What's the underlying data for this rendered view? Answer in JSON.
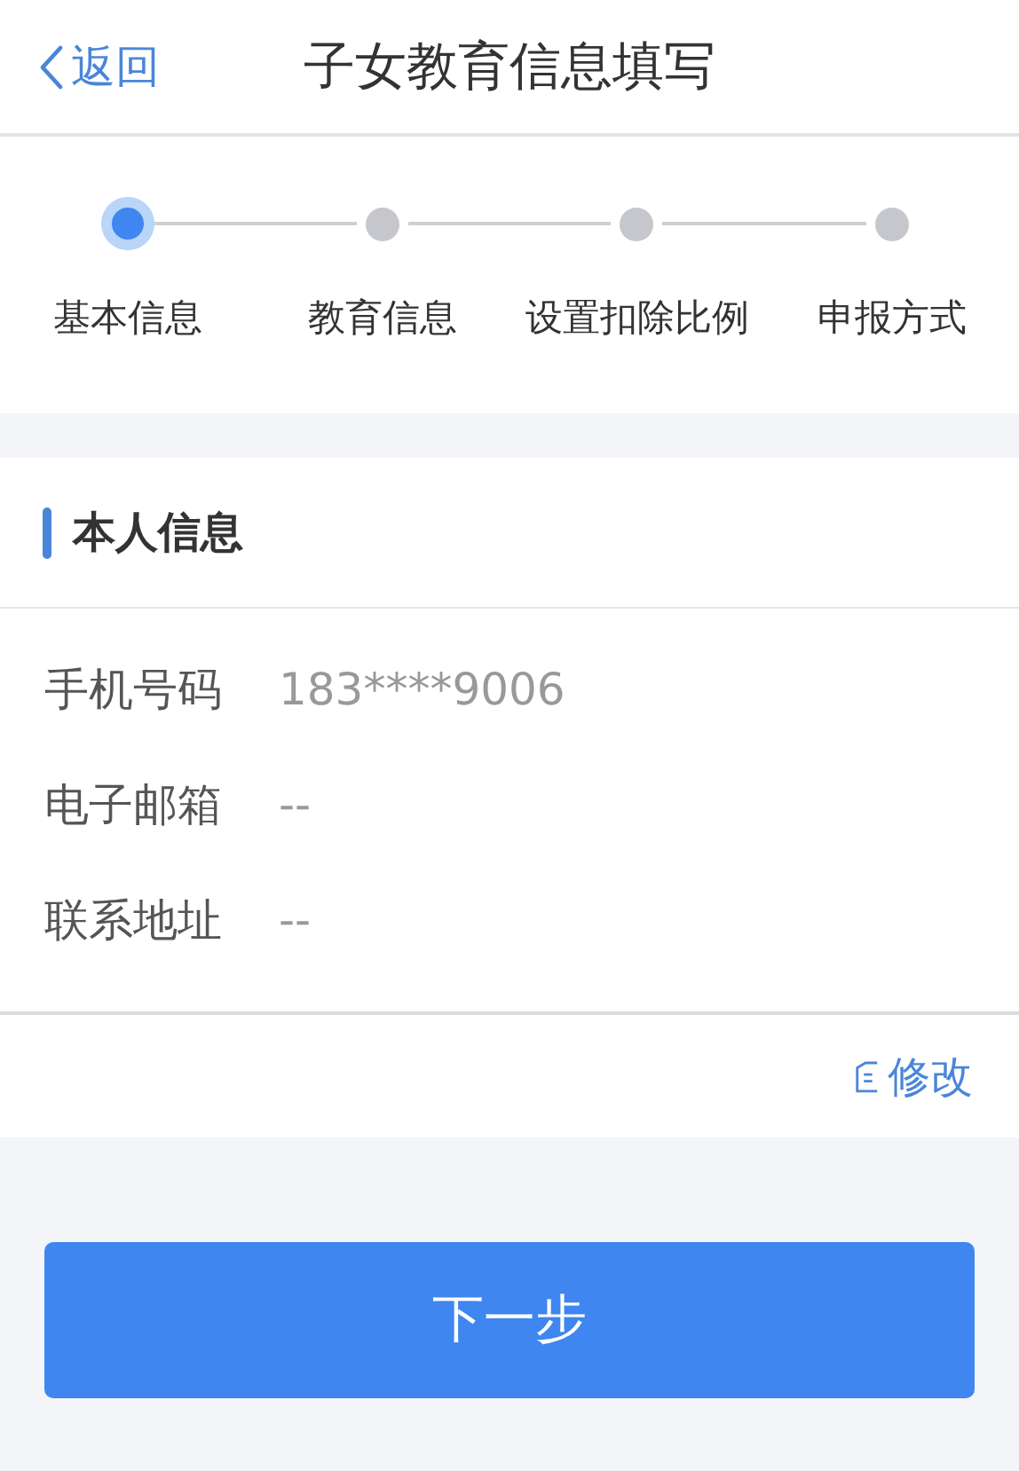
{
  "nav": {
    "back": "返回",
    "title": "子女教育信息填写"
  },
  "steps": [
    {
      "label": "基本信息",
      "selected": true
    },
    {
      "label": "教育信息",
      "selected": false
    },
    {
      "label": "设置扣除比例",
      "selected": false
    },
    {
      "label": "申报方式",
      "selected": false
    }
  ],
  "section": {
    "title": "本人信息",
    "fields": [
      {
        "label": "手机号码",
        "value": "183****9006"
      },
      {
        "label": "电子邮箱",
        "value": "--"
      },
      {
        "label": "联系地址",
        "value": "--"
      }
    ],
    "edit": "修改"
  },
  "next_button": "下一步"
}
